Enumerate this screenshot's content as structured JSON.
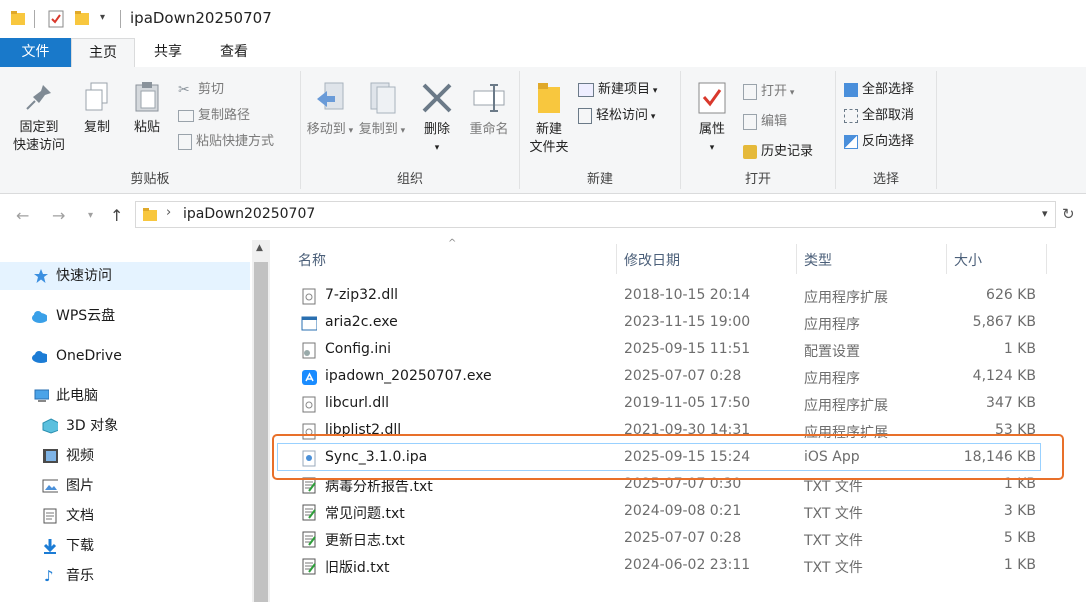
{
  "window": {
    "title": "ipaDown20250707"
  },
  "tabs": {
    "file": "文件",
    "home": "主页",
    "share": "共享",
    "view": "查看"
  },
  "ribbon": {
    "clipboard": {
      "label": "剪贴板",
      "pin_line1": "固定到",
      "pin_line2": "快速访问",
      "copy": "复制",
      "paste": "粘贴",
      "cut": "剪切",
      "copy_path": "复制路径",
      "paste_shortcut": "粘贴快捷方式"
    },
    "organize": {
      "label": "组织",
      "move_to": "移动到",
      "copy_to": "复制到",
      "delete": "删除",
      "rename": "重命名"
    },
    "new": {
      "label": "新建",
      "new_folder_line1": "新建",
      "new_folder_line2": "文件夹",
      "new_item": "新建项目",
      "easy_access": "轻松访问"
    },
    "open": {
      "label": "打开",
      "properties": "属性",
      "open": "打开",
      "edit": "编辑",
      "history": "历史记录"
    },
    "select": {
      "label": "选择",
      "select_all": "全部选择",
      "select_none": "全部取消",
      "invert": "反向选择"
    }
  },
  "address": {
    "path": "ipaDown20250707"
  },
  "nav": {
    "items": [
      "快速访问",
      "WPS云盘",
      "OneDrive",
      "此电脑",
      "3D 对象",
      "视频",
      "图片",
      "文档",
      "下载",
      "音乐"
    ]
  },
  "columns": {
    "name": "名称",
    "date": "修改日期",
    "type": "类型",
    "size": "大小"
  },
  "files": [
    {
      "name": "7-zip32.dll",
      "date": "2018-10-15 20:14",
      "type": "应用程序扩展",
      "size": "626 KB",
      "icon": "dll-icon"
    },
    {
      "name": "aria2c.exe",
      "date": "2023-11-15 19:00",
      "type": "应用程序",
      "size": "5,867 KB",
      "icon": "exe-icon"
    },
    {
      "name": "Config.ini",
      "date": "2025-09-15 11:51",
      "type": "配置设置",
      "size": "1 KB",
      "icon": "ini-icon"
    },
    {
      "name": "ipadown_20250707.exe",
      "date": "2025-07-07 0:28",
      "type": "应用程序",
      "size": "4,124 KB",
      "icon": "appstore-icon"
    },
    {
      "name": "libcurl.dll",
      "date": "2019-11-05 17:50",
      "type": "应用程序扩展",
      "size": "347 KB",
      "icon": "dll-icon"
    },
    {
      "name": "libplist2.dll",
      "date": "2021-09-30 14:31",
      "type": "应用程序扩展",
      "size": "53 KB",
      "icon": "dll-icon"
    },
    {
      "name": "Sync_3.1.0.ipa",
      "date": "2025-09-15 15:24",
      "type": "iOS App",
      "size": "18,146 KB",
      "icon": "ipa-icon"
    },
    {
      "name": "病毒分析报告.txt",
      "date": "2025-07-07 0:30",
      "type": "TXT 文件",
      "size": "1 KB",
      "icon": "txt-icon"
    },
    {
      "name": "常见问题.txt",
      "date": "2024-09-08 0:21",
      "type": "TXT 文件",
      "size": "3 KB",
      "icon": "txt-icon"
    },
    {
      "name": "更新日志.txt",
      "date": "2025-07-07 0:28",
      "type": "TXT 文件",
      "size": "5 KB",
      "icon": "txt-icon"
    },
    {
      "name": "旧版id.txt",
      "date": "2024-06-02 23:11",
      "type": "TXT 文件",
      "size": "1 KB",
      "icon": "txt-icon"
    }
  ],
  "colors": {
    "accent": "#1979ca",
    "highlight": "#e8702a",
    "selection_border": "#99d1ff"
  }
}
